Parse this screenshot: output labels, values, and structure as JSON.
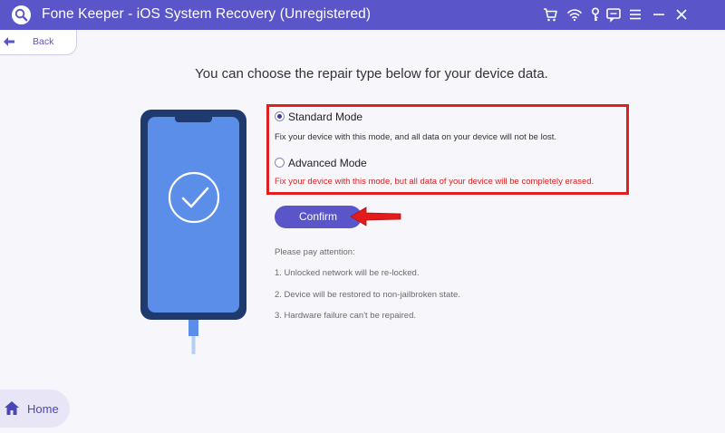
{
  "app": {
    "title": "Fone Keeper - iOS System Recovery (Unregistered)",
    "accent_color": "#5a56c9",
    "logo_icon": "wrench-magnifier-icon"
  },
  "titlebar_icons": [
    "cart-icon",
    "wifi-icon",
    "key-icon",
    "chat-icon",
    "menu-icon",
    "minimize-icon",
    "close-icon"
  ],
  "nav": {
    "back_label": "Back",
    "home_label": "Home"
  },
  "main": {
    "headline": "You can choose the repair type below for your device data.",
    "modes": [
      {
        "title": "Standard Mode",
        "description": "Fix your device with this mode, and all data on your device will not be lost.",
        "selected": true,
        "desc_color": "#333333"
      },
      {
        "title": "Advanced Mode",
        "description": "Fix your device with this mode, but all data of your device will be completely erased.",
        "selected": false,
        "desc_color": "#e02020"
      }
    ],
    "confirm_label": "Confirm",
    "notes": {
      "title": "Please pay attention:",
      "items": [
        "1. Unlocked network will be re-locked.",
        "2. Device will be restored to non-jailbroken state.",
        "3. Hardware failure can't be repaired."
      ]
    }
  }
}
